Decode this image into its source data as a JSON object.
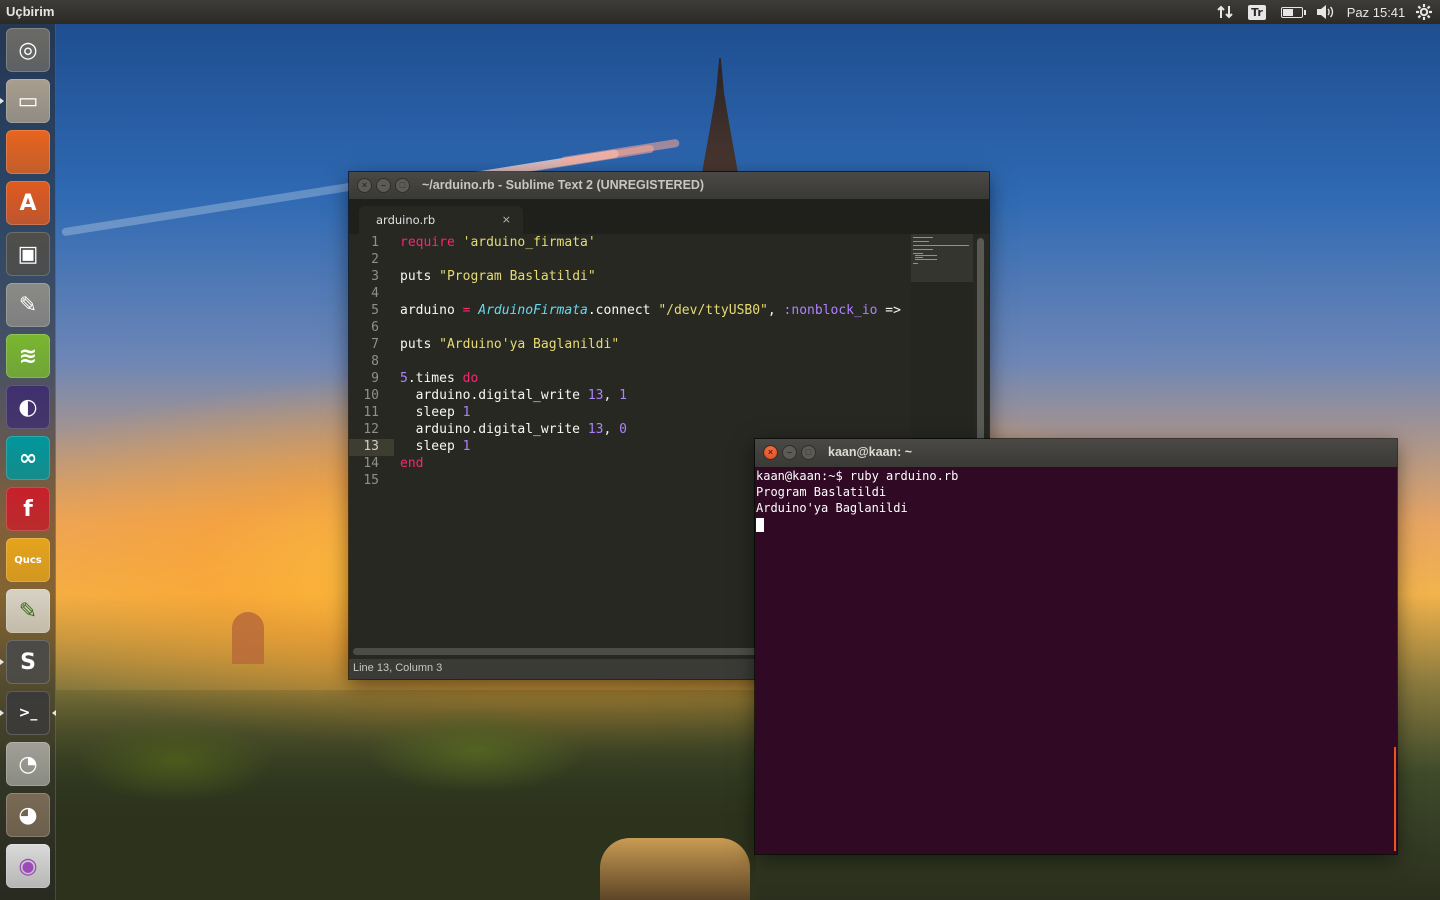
{
  "top_panel": {
    "app_name": "Uçbirim",
    "keyboard_layout": "Tr",
    "clock": "Paz 15:41",
    "battery_level": 0.6
  },
  "launcher": {
    "items": [
      {
        "name": "dash-home",
        "icon": "ubuntu-logo-icon",
        "color": "#6b6a66"
      },
      {
        "name": "files",
        "icon": "file-cabinet-icon",
        "color": "#a99e8e"
      },
      {
        "name": "firefox",
        "icon": "firefox-icon",
        "color": "#e8641e"
      },
      {
        "name": "software-center",
        "icon": "software-center-icon",
        "color": "#e05a20"
      },
      {
        "name": "workspace-switcher",
        "icon": "workspace-switcher-icon",
        "color": "#4f4e4a"
      },
      {
        "name": "system-settings",
        "icon": "settings-tools-icon",
        "color": "#8c8b86"
      },
      {
        "name": "spotify",
        "icon": "spotify-icon",
        "color": "#7ab72f"
      },
      {
        "name": "eclipse",
        "icon": "eclipse-icon",
        "color": "#3f2f6e"
      },
      {
        "name": "arduino",
        "icon": "arduino-icon",
        "color": "#00979c"
      },
      {
        "name": "fritzing",
        "icon": "fritzing-icon",
        "color": "#c8202a"
      },
      {
        "name": "qucs",
        "icon": "qucs-icon",
        "color": "#e6a41c"
      },
      {
        "name": "text-editor",
        "icon": "text-editor-icon",
        "color": "#d7d2c6"
      },
      {
        "name": "sublime-text",
        "icon": "sublime-icon",
        "color": "#4a4a48"
      },
      {
        "name": "terminal",
        "icon": "terminal-icon",
        "color": "#3a3a3a"
      },
      {
        "name": "disk-usage",
        "icon": "disk-usage-icon",
        "color": "#a0a098"
      },
      {
        "name": "gimp",
        "icon": "gimp-icon",
        "color": "#7a6a55"
      },
      {
        "name": "dvd-burner",
        "icon": "disc-icon",
        "color": "#d9d9d9"
      }
    ],
    "glyphs": {
      "dash-home": "◎",
      "files": "▭",
      "firefox": "",
      "software-center": "A",
      "workspace-switcher": "▣",
      "system-settings": "✎",
      "spotify": "≋",
      "eclipse": "◐",
      "arduino": "∞",
      "fritzing": "f",
      "qucs": "Qucs",
      "text-editor": "✎",
      "sublime-text": "S",
      "terminal": ">_",
      "disk-usage": "◔",
      "gimp": "◕",
      "dvd-burner": "◉"
    }
  },
  "sublime": {
    "title": "~/arduino.rb - Sublime Text 2 (UNREGISTERED)",
    "tab_label": "arduino.rb",
    "tab_close": "×",
    "status": "Line 13, Column 3",
    "current_line": 13,
    "line_numbers": [
      "1",
      "2",
      "3",
      "4",
      "5",
      "6",
      "7",
      "8",
      "9",
      "10",
      "11",
      "12",
      "13",
      "14",
      "15"
    ],
    "code": {
      "l1_kw": "require",
      "l1_str": "'arduino_firmata'",
      "l3_plain": "puts ",
      "l3_str": "\"Program Baslatildi\"",
      "l5_a": "arduino ",
      "l5_op": "=",
      "l5_sp": " ",
      "l5_cls": "ArduinoFirmata",
      "l5_b": ".connect ",
      "l5_str": "\"/dev/ttyUSB0\"",
      "l5_c": ", ",
      "l5_sym": ":nonblock_io",
      "l5_d": " =>",
      "l7_plain": "puts ",
      "l7_str": "\"Arduino'ya Baglanildi\"",
      "l9_num": "5",
      "l9_plain": ".times ",
      "l9_kw": "do",
      "l10_plain": "  arduino.digital_write ",
      "l10_n1": "13",
      "l10_c": ", ",
      "l10_n2": "1",
      "l11_plain": "  sleep ",
      "l11_n": "1",
      "l12_plain": "  arduino.digital_write ",
      "l12_n1": "13",
      "l12_c": ", ",
      "l12_n2": "0",
      "l13_plain": "  sleep ",
      "l13_n": "1",
      "l14_kw": "end"
    },
    "colors": {
      "background": "#272822",
      "keyword": "#f92672",
      "string": "#e6db74",
      "class": "#66d9ef",
      "number": "#ae81ff"
    }
  },
  "terminal": {
    "title": "kaan@kaan: ~",
    "lines": [
      "kaan@kaan:~$ ruby arduino.rb",
      "Program Baslatildi",
      "Arduino'ya Baglanildi"
    ],
    "colors": {
      "background": "#300a24",
      "scroll_accent": "#e95420"
    }
  },
  "window_controls": {
    "close": "×",
    "minimize": "–",
    "maximize": "□"
  }
}
